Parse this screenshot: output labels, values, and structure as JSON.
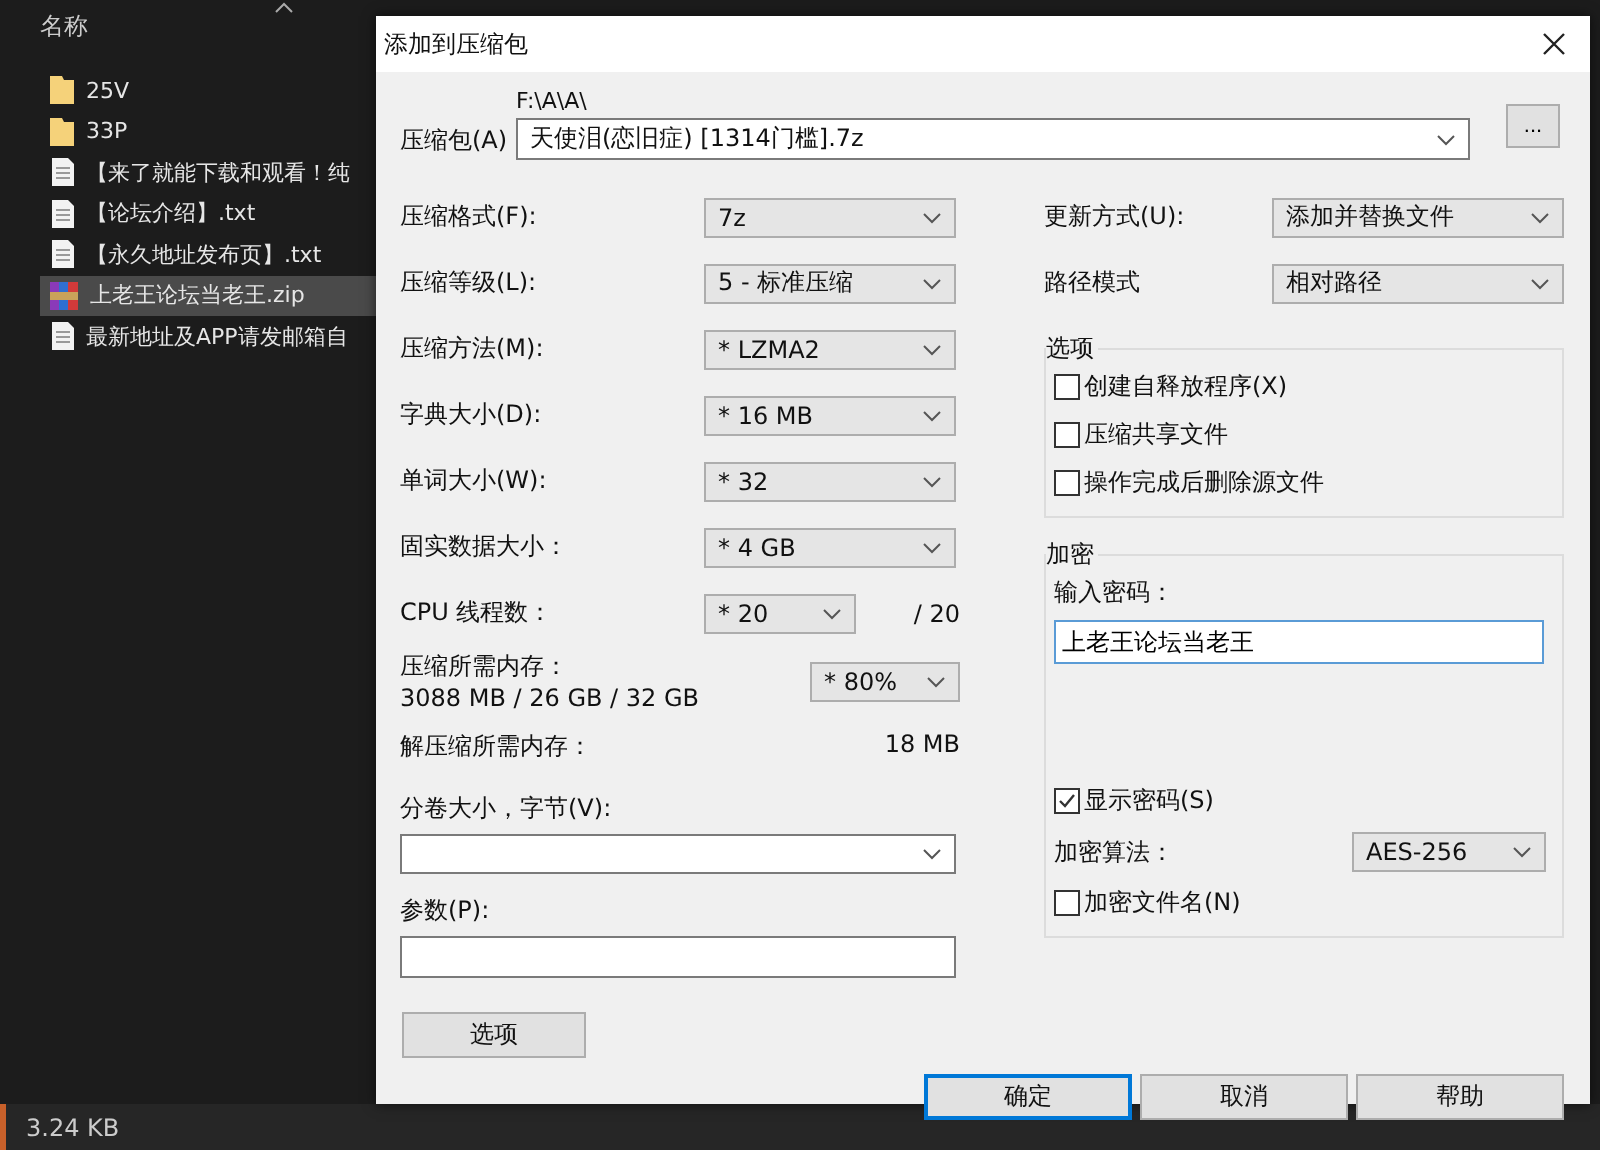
{
  "explorer": {
    "column_header": "名称",
    "files": [
      {
        "name": "25V",
        "kind": "folder",
        "selected": false
      },
      {
        "name": "33P",
        "kind": "folder",
        "selected": false
      },
      {
        "name": "【来了就能下载和观看！纯",
        "kind": "text",
        "selected": false
      },
      {
        "name": "【论坛介绍】.txt",
        "kind": "text",
        "selected": false
      },
      {
        "name": "【永久地址发布页】.txt",
        "kind": "text",
        "selected": false
      },
      {
        "name": "上老王论坛当老王.zip",
        "kind": "archive",
        "selected": true
      },
      {
        "name": "最新地址及APP请发邮箱自",
        "kind": "text",
        "selected": false
      }
    ],
    "status": "3.24 KB"
  },
  "dialog": {
    "title": "添加到压缩包",
    "archive": {
      "label": "压缩包(A)",
      "path": "F:\\A\\A\\",
      "value": "天使泪(恋旧症) [1314门槛].7z"
    },
    "browse_button": "...",
    "settings": [
      {
        "label": "压缩格式(F):",
        "value": "7z",
        "kind": "select"
      },
      {
        "label": "压缩等级(L):",
        "value": "5 - 标准压缩",
        "kind": "select"
      },
      {
        "label": "压缩方法(M):",
        "value": "* LZMA2",
        "kind": "select"
      },
      {
        "label": "字典大小(D):",
        "value": "* 16 MB",
        "kind": "select"
      },
      {
        "label": "单词大小(W):",
        "value": "* 32",
        "kind": "select"
      },
      {
        "label": "固实数据大小：",
        "value": "* 4 GB",
        "kind": "select"
      },
      {
        "label": "CPU 线程数：",
        "value": "* 20",
        "kind": "short",
        "suffix": "/ 20"
      }
    ],
    "memory": {
      "label": "压缩所需内存：",
      "detail": "3088 MB / 26 GB / 32 GB",
      "value": "* 80%"
    },
    "decompress_memory": {
      "label": "解压缩所需内存：",
      "value": "18 MB"
    },
    "volume": {
      "label": "分卷大小，字节(V):"
    },
    "parameters": {
      "label": "参数(P):"
    },
    "options_button": "选项",
    "update_mode": {
      "label": "更新方式(U):",
      "value": "添加并替换文件"
    },
    "path_mode": {
      "label": "路径模式",
      "value": "相对路径"
    },
    "options_group": {
      "title": "选项",
      "items": [
        {
          "label": "创建自释放程序(X)",
          "checked": false
        },
        {
          "label": "压缩共享文件",
          "checked": false
        },
        {
          "label": "操作完成后删除源文件",
          "checked": false
        }
      ]
    },
    "encryption": {
      "title": "加密",
      "password_label": "输入密码：",
      "password": "上老王论坛当老王",
      "show_password": {
        "label": "显示密码(S)",
        "checked": true
      },
      "method_label": "加密算法：",
      "method": "AES-256",
      "encrypt_names": {
        "label": "加密文件名(N)",
        "checked": false
      }
    },
    "buttons": [
      {
        "label": "确定",
        "default": true
      },
      {
        "label": "取消",
        "default": false
      },
      {
        "label": "帮助",
        "default": false
      }
    ]
  }
}
